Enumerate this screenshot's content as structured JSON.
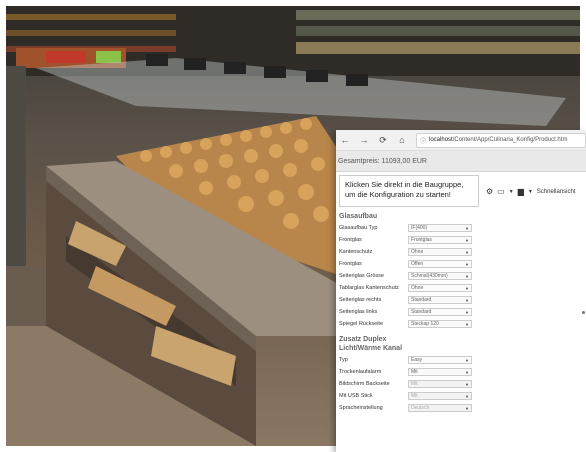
{
  "browser": {
    "nav": {
      "back": "←",
      "forward": "→",
      "reload": "⟳",
      "home": "⌂"
    },
    "url_host": "localhost",
    "url_path": "/Content/App/Culinaria_Konfig/Product.htm",
    "price_label": "Gesamtpreis: 11093,00 EUR"
  },
  "config": {
    "intro": "Klicken Sie direkt in die Baugruppe, um die Konfiguration zu starten!",
    "sections": [
      {
        "title": "Glasaufbau",
        "rows": [
          {
            "label": "Glasaufbau Typ",
            "value": "IF(400)"
          },
          {
            "label": "Frontglas",
            "value": "Frontglas"
          },
          {
            "label": "Kantenschutz",
            "value": "Ohne"
          },
          {
            "label": "Frontglas",
            "value": "Offen"
          },
          {
            "label": "Seitenglas Grösse",
            "value": "Schmal(430mm)"
          },
          {
            "label": "Tablarglas Kantenschutz",
            "value": "Ohne"
          },
          {
            "label": "Seitenglas rechts",
            "value": "Standard"
          },
          {
            "label": "Seitenglas links",
            "value": "Standard"
          },
          {
            "label": "Spiegel Rückseite",
            "value": "Steckap 120"
          }
        ]
      },
      {
        "title": "Zusatz Duplex",
        "rows": []
      },
      {
        "title": "Licht/Wärme Kanal",
        "rows": [
          {
            "label": "Typ",
            "value": "Easy",
            "disabled": false
          },
          {
            "label": "Trockenlaufalarm",
            "value": "Mit",
            "disabled": false
          },
          {
            "label": "Bildschirm Backseite",
            "value": "Mit",
            "disabled": true
          },
          {
            "label": "Mit USB Stick",
            "value": "Mit",
            "disabled": true
          },
          {
            "label": "Spracheinstellung",
            "value": "Deutsch",
            "disabled": true
          }
        ]
      }
    ]
  },
  "toolbar": {
    "icons": [
      "gear-icon",
      "document-icon",
      "layers-icon",
      "view-dropdown-icon"
    ],
    "label": "Schnellansicht"
  }
}
